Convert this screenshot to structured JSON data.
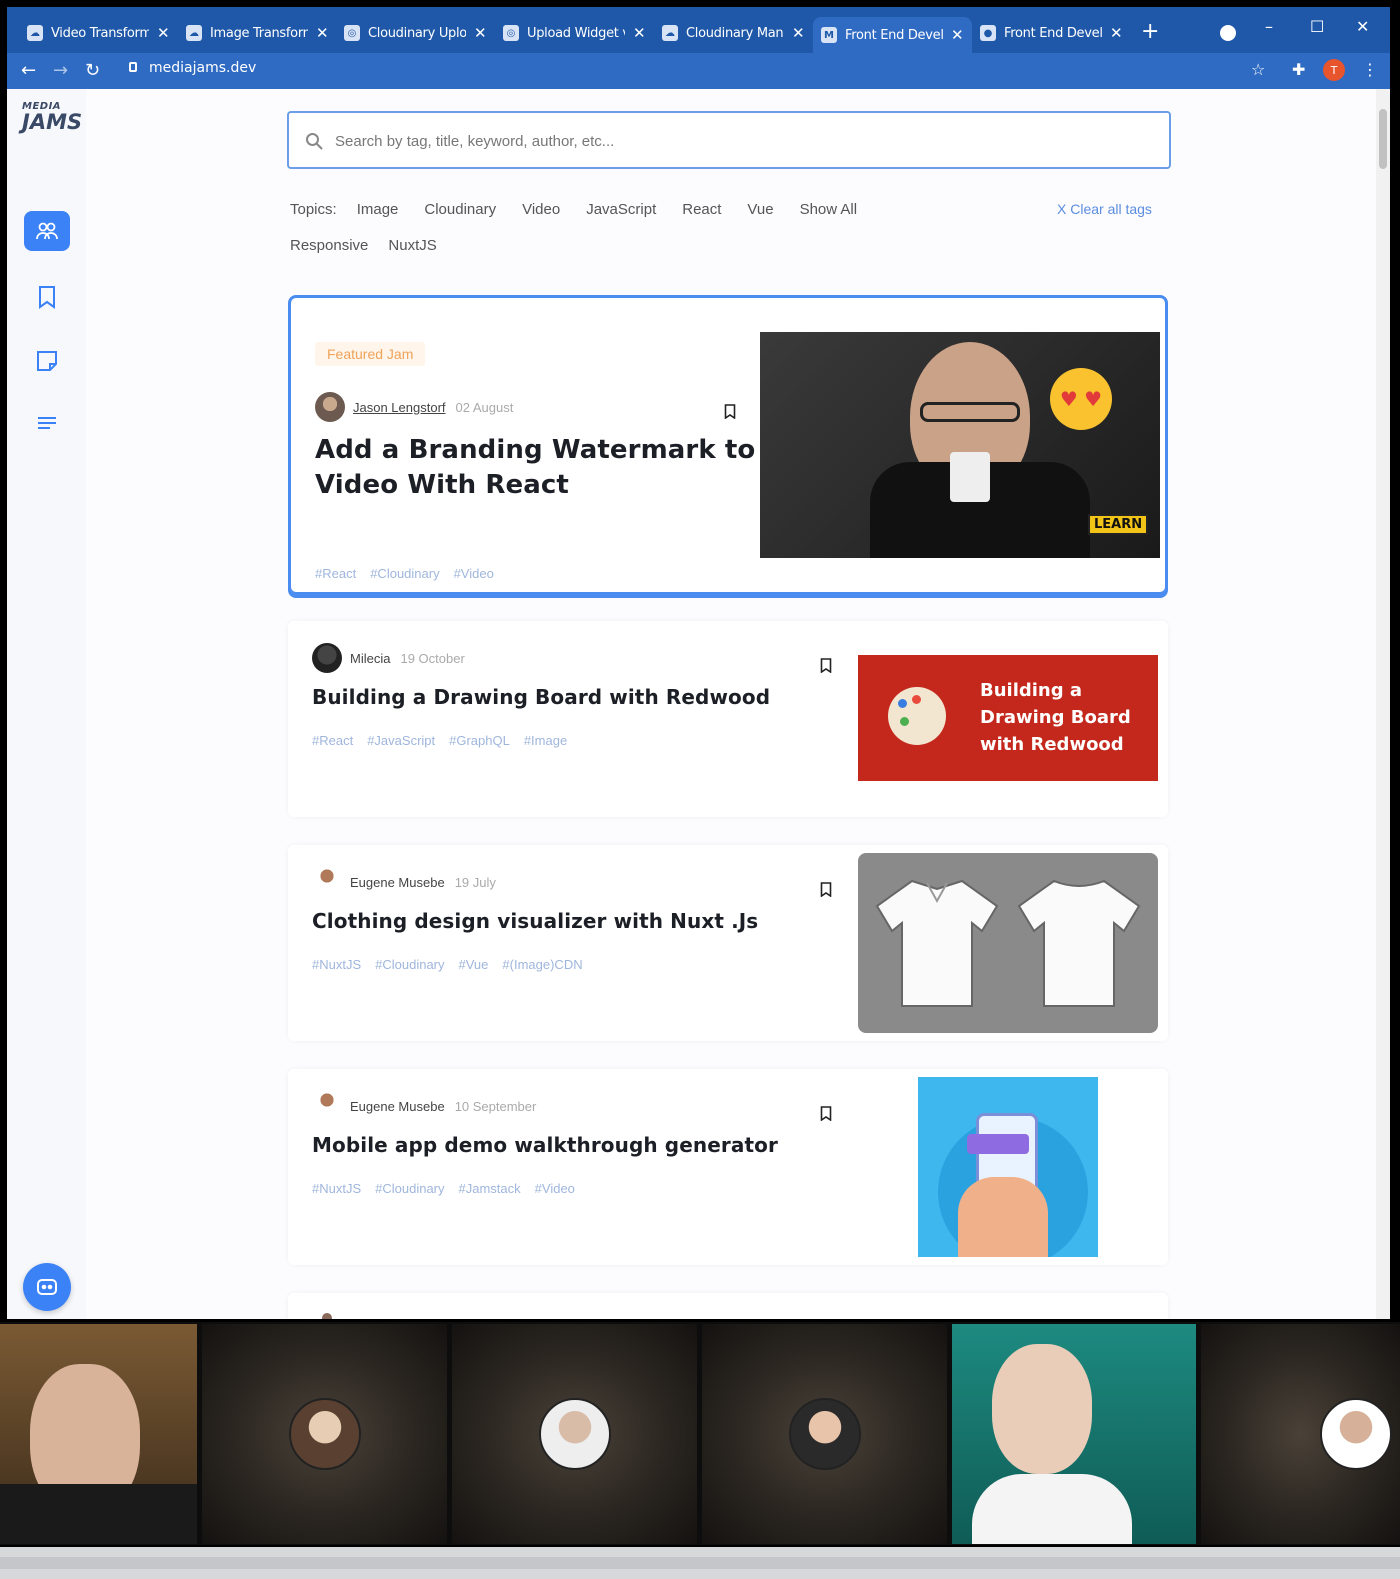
{
  "browser": {
    "tabs": [
      {
        "title": "Video Transforma",
        "active": false
      },
      {
        "title": "Image Transforma",
        "active": false
      },
      {
        "title": "Cloudinary Uploa",
        "active": false
      },
      {
        "title": "Upload Widget v",
        "active": false
      },
      {
        "title": "Cloudinary Mana",
        "active": false
      },
      {
        "title": "Front End Develo",
        "active": true
      },
      {
        "title": "Front End Develo",
        "active": false
      }
    ],
    "url": "mediajams.dev",
    "profile_initial": "T",
    "colors": {
      "tabbar": "#1f58a8",
      "addressbar": "#2f6bc2"
    }
  },
  "sidebar": {
    "logo_top": "MEDIA",
    "logo_bottom": "JAMS",
    "items": [
      {
        "name": "community-icon",
        "active": true
      },
      {
        "name": "bookmark-icon",
        "active": false
      },
      {
        "name": "note-icon",
        "active": false
      },
      {
        "name": "list-icon",
        "active": false
      }
    ],
    "discord": "discord-icon"
  },
  "search": {
    "placeholder": "Search by tag, title, keyword, author, etc..."
  },
  "topics": {
    "label": "Topics:",
    "row1": [
      "Image",
      "Cloudinary",
      "Video",
      "JavaScript",
      "React",
      "Vue",
      "Show All"
    ],
    "row2": [
      "Responsive",
      "NuxtJS"
    ],
    "clear": "X Clear all tags"
  },
  "featured": {
    "badge": "Featured Jam",
    "author": "Jason Lengstorf",
    "date": "02 August",
    "title_l1": "Add a Branding Watermark to",
    "title_l2": "Video With React",
    "tags": [
      "#React",
      "#Cloudinary",
      "#Video"
    ],
    "thumb_label": "LEARN"
  },
  "jams": [
    {
      "author": "Milecia",
      "date": "19 October",
      "title": "Building a Drawing Board with Redwood",
      "tags": [
        "#React",
        "#JavaScript",
        "#GraphQL",
        "#Image"
      ],
      "thumb_lines": [
        "Building a",
        "Drawing Board",
        "with Redwood"
      ]
    },
    {
      "author": "Eugene Musebe",
      "date": "19 July",
      "title": "Clothing design visualizer with Nuxt .Js",
      "tags": [
        "#NuxtJS",
        "#Cloudinary",
        "#Vue",
        "#(Image)CDN"
      ]
    },
    {
      "author": "Eugene Musebe",
      "date": "10 September",
      "title": "Mobile app demo walkthrough generator",
      "tags": [
        "#NuxtJS",
        "#Cloudinary",
        "#Jamstack",
        "#Video"
      ]
    }
  ]
}
